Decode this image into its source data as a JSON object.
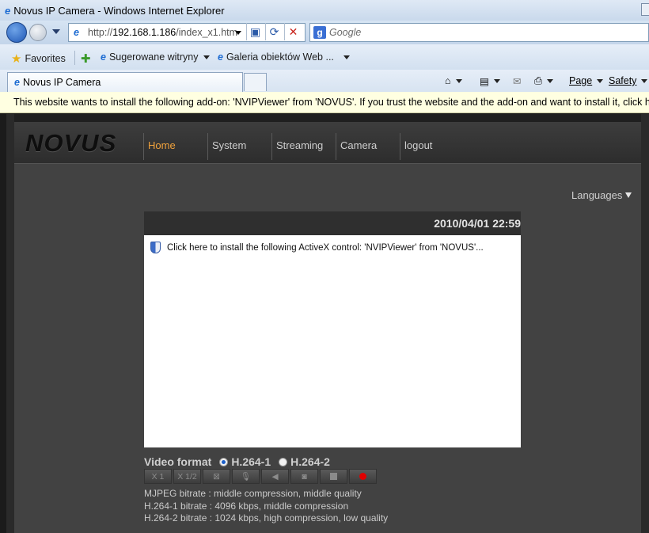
{
  "window": {
    "title": "Novus IP Camera - Windows Internet Explorer"
  },
  "address": {
    "scheme": "http://",
    "host": "192.168.1.186",
    "path": "/index_x1.htm",
    "search_placeholder": "Google"
  },
  "favorites": {
    "label": "Favorites",
    "items": [
      "Sugerowane witryny",
      "Galeria obiektów Web ..."
    ]
  },
  "tab": {
    "title": "Novus IP Camera"
  },
  "commands": {
    "page": "Page",
    "safety": "Safety"
  },
  "infobar": {
    "text": "This website wants to install the following add-on: 'NVIPViewer' from 'NOVUS'. If you trust the website and the add-on and want to install it, click here..."
  },
  "site": {
    "logo": "NOVUS",
    "nav": [
      "Home",
      "System",
      "Streaming",
      "Camera",
      "logout"
    ],
    "active_nav": "Home",
    "languages": "Languages",
    "datetime": "2010/04/01 22:59",
    "activex_prompt": "Click here to install the following ActiveX control: 'NVIPViewer' from 'NOVUS'...",
    "video_format_label": "Video format",
    "formats": [
      {
        "label": "H.264-1",
        "selected": true
      },
      {
        "label": "H.264-2",
        "selected": false
      }
    ],
    "controls": {
      "x1": "X 1",
      "x12": "X 1/2"
    },
    "bitrates": [
      "MJPEG bitrate : middle compression, middle quality",
      "H.264-1 bitrate : 4096 kbps, middle compression",
      "H.264-2 bitrate : 1024 kbps, high compression, low quality"
    ]
  },
  "colors": {
    "accent": "#f0a23c",
    "page_bg": "#424242",
    "record": "#e00000"
  }
}
